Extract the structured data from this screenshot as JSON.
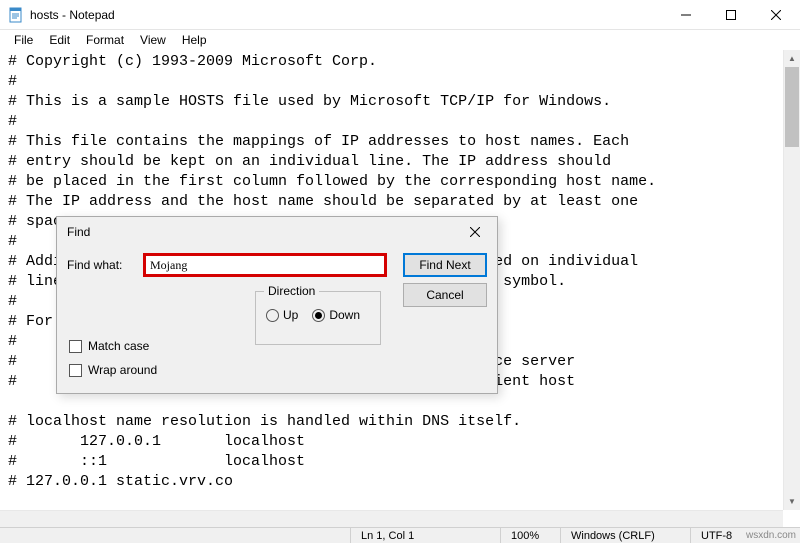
{
  "window": {
    "title": "hosts - Notepad"
  },
  "menu": {
    "file": "File",
    "edit": "Edit",
    "format": "Format",
    "view": "View",
    "help": "Help"
  },
  "document_lines": [
    "# Copyright (c) 1993-2009 Microsoft Corp.",
    "#",
    "# This is a sample HOSTS file used by Microsoft TCP/IP for Windows.",
    "#",
    "# This file contains the mappings of IP addresses to host names. Each",
    "# entry should be kept on an individual line. The IP address should",
    "# be placed in the first column followed by the corresponding host name.",
    "# The IP address and the host name should be separated by at least one",
    "# space.",
    "#",
    "# Additionally, comments (such as these) may be inserted on individual",
    "# lines or following the machine name denoted by a '#' symbol.",
    "#",
    "# For example:",
    "#",
    "#      102.54.94.97     rhino.acme.com          # source server",
    "#       38.25.63.10     x.acme.com              # x client host",
    "",
    "# localhost name resolution is handled within DNS itself.",
    "#       127.0.0.1       localhost",
    "#       ::1             localhost",
    "# 127.0.0.1 static.vrv.co"
  ],
  "find": {
    "title": "Find",
    "label": "Find what:",
    "value": "Mojang",
    "find_next": "Find Next",
    "cancel": "Cancel",
    "direction_label": "Direction",
    "up": "Up",
    "down": "Down",
    "direction_selected": "down",
    "match_case": "Match case",
    "wrap_around": "Wrap around",
    "match_case_checked": false,
    "wrap_around_checked": false
  },
  "statusbar": {
    "position": "Ln 1, Col 1",
    "zoom": "100%",
    "line_ending": "Windows (CRLF)",
    "encoding": "UTF-8"
  },
  "watermark": "wsxdn.com"
}
